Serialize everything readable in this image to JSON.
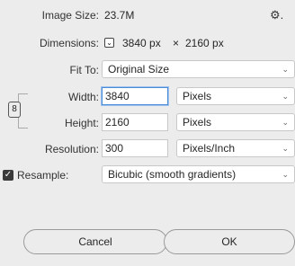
{
  "image_size": {
    "label": "Image Size:",
    "value": "23.7M"
  },
  "gear_menu": {
    "icon": "gear-icon",
    "arrow": "."
  },
  "dimensions": {
    "label": "Dimensions:",
    "width": "3840 px",
    "times": "×",
    "height": "2160 px"
  },
  "fit_to": {
    "label": "Fit To:",
    "value": "Original Size"
  },
  "width": {
    "label": "Width:",
    "value": "3840",
    "unit": "Pixels"
  },
  "height": {
    "label": "Height:",
    "value": "2160",
    "unit": "Pixels"
  },
  "resolution": {
    "label": "Resolution:",
    "value": "300",
    "unit": "Pixels/Inch"
  },
  "resample": {
    "label": "Resample:",
    "checked": true,
    "method": "Bicubic (smooth gradients)"
  },
  "buttons": {
    "cancel": "Cancel",
    "ok": "OK"
  },
  "icons": {
    "chevron": "chevron-down-icon",
    "link": "chain-link-icon",
    "check": "checkmark-icon"
  }
}
